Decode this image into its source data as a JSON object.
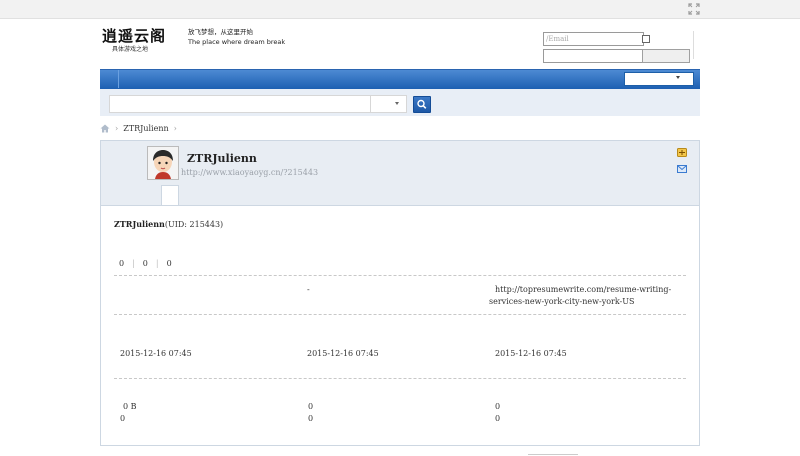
{
  "logo": {
    "cn": "逍遥云阁",
    "sub": "具体游戏之地"
  },
  "slogan": {
    "line1": "放飞梦想，从这里开始",
    "line2": "The place where dream break"
  },
  "login": {
    "email_placeholder": "/Email",
    "password_value": ""
  },
  "breadcrumb": {
    "items": [
      "ZTRJulienn"
    ]
  },
  "profile": {
    "name": "ZTRJulienn",
    "url": "http://www.xiaoyaoyg.cn/?215443"
  },
  "summary": {
    "name": "ZTRJulienn",
    "uid": "(UID: 215443)",
    "stats": [
      "0",
      "0",
      "0"
    ]
  },
  "info_row": {
    "col2": "-",
    "col3": "http://topresumewrite.com/resume-writing-services-new-york-city-new-york-US"
  },
  "dates": [
    "2015-12-16 07:45",
    "2015-12-16 07:45",
    "2015-12-16 07:45"
  ],
  "bottom": {
    "col1": [
      "0 B",
      "0"
    ],
    "col2": [
      "0",
      "0"
    ],
    "col3": [
      "0",
      "0"
    ]
  },
  "colors": {
    "nav_blue": "#1a5db0",
    "search_bg": "#e8eef6",
    "profile_bg": "#e8edf3"
  },
  "icons": [
    "expand-icon",
    "home-icon",
    "search-icon",
    "avatar-image",
    "friend-add-icon",
    "message-icon"
  ]
}
